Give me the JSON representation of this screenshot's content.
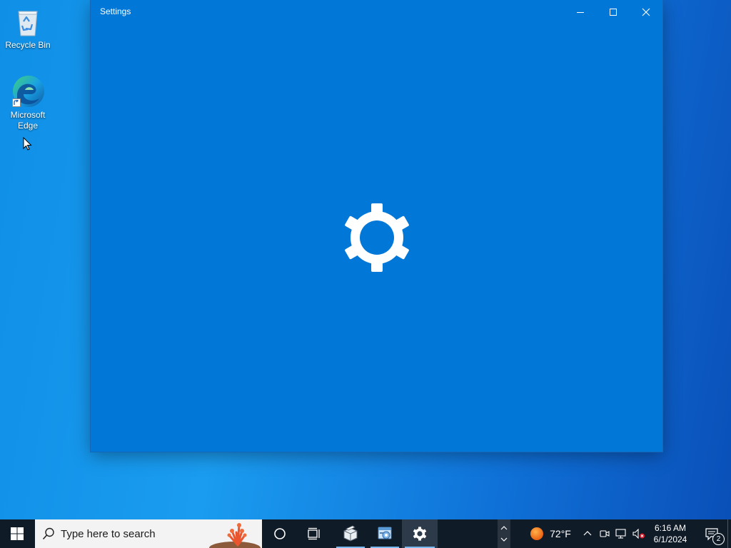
{
  "desktop": {
    "icons": [
      {
        "label": "Recycle Bin"
      },
      {
        "label": "Microsoft\nEdge"
      }
    ]
  },
  "window": {
    "title": "Settings",
    "background": "#0178d7"
  },
  "taskbar": {
    "search_placeholder": "Type here to search",
    "weather_temp": "72°F",
    "time": "6:16 AM",
    "date": "6/1/2024",
    "notification_count": "2"
  },
  "colors": {
    "taskbar_bg": "#101b28",
    "accent": "#0178d7"
  }
}
